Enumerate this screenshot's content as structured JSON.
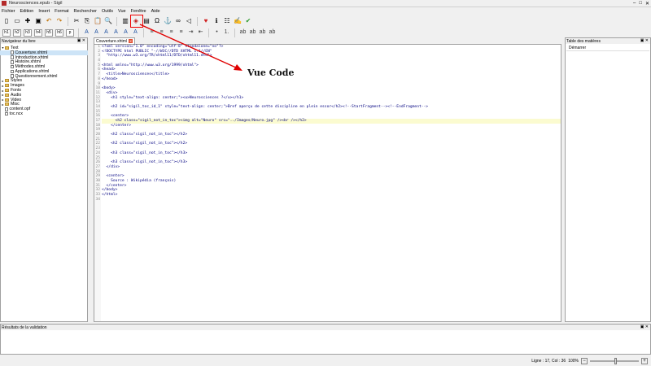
{
  "window": {
    "title": "Neurosciences.epub - Sigil",
    "controls": [
      "–",
      "□",
      "✕"
    ]
  },
  "menu": [
    "Fichier",
    "Edition",
    "Insert",
    "Format",
    "Rechercher",
    "Outils",
    "Vue",
    "Fenêtre",
    "Aide"
  ],
  "toolbar": {
    "icons1": [
      "new-file-icon",
      "open-folder-icon",
      "add-file-icon",
      "save-icon",
      "undo-icon",
      "redo-icon",
      "cut-icon",
      "copy-icon",
      "paste-icon",
      "find-icon",
      "book-view-icon",
      "code-view-icon",
      "insert-image-icon",
      "special-char-icon",
      "anchor-icon",
      "link-icon",
      "back-icon",
      "heart-icon",
      "info-icon",
      "metadata-icon",
      "spellcheck-icon",
      "validate-icon"
    ],
    "glyphs1": [
      "▯",
      "▭",
      "✚",
      "▣",
      "↶",
      "↷",
      "✂",
      "⎘",
      "📋",
      "🔍",
      "▥",
      "◈",
      "▤",
      "Ω",
      "⚓",
      "∞",
      "◁",
      "♥",
      "ℹ",
      "☷",
      "✍",
      "✔"
    ],
    "headings": [
      "h1",
      "h2",
      "h3",
      "h4",
      "h5",
      "h6",
      "p"
    ],
    "icons2": [
      "bold-icon",
      "italic-icon",
      "underline-icon",
      "strike-icon",
      "subscript-icon",
      "superscript-icon",
      "align-left-icon",
      "align-center-icon",
      "align-right-icon",
      "justify-icon",
      "indent-icon",
      "outdent-icon",
      "list-icon",
      "numbered-list-icon",
      "small-ab-icon",
      "smaller-ab-icon",
      "case-ab-icon",
      "case2-ab-icon"
    ],
    "glyphs2": [
      "A",
      "A",
      "A",
      "A",
      "A",
      "A",
      "≡",
      "≡",
      "≡",
      "≡",
      "⇥",
      "⇤",
      "•",
      "1.",
      "ab",
      "ab",
      "ab",
      "ab"
    ]
  },
  "book_browser": {
    "title": "Navigateur du livre",
    "tree": [
      {
        "label": "Text",
        "type": "folder",
        "level": 0,
        "open": true
      },
      {
        "label": "Couverture.xhtml",
        "type": "file",
        "level": 1,
        "selected": true
      },
      {
        "label": "Introduction.xhtml",
        "type": "file",
        "level": 1
      },
      {
        "label": "Histoire.xhtml",
        "type": "file",
        "level": 1
      },
      {
        "label": "Méthodes.xhtml",
        "type": "file",
        "level": 1
      },
      {
        "label": "Applications.xhtml",
        "type": "file",
        "level": 1
      },
      {
        "label": "Questionnement.xhtml",
        "type": "file",
        "level": 1
      },
      {
        "label": "Styles",
        "type": "folder",
        "level": 0
      },
      {
        "label": "Images",
        "type": "folder",
        "level": 0
      },
      {
        "label": "Fonts",
        "type": "folder",
        "level": 0
      },
      {
        "label": "Audio",
        "type": "folder",
        "level": 0
      },
      {
        "label": "Video",
        "type": "folder",
        "level": 0
      },
      {
        "label": "Misc",
        "type": "folder",
        "level": 0
      },
      {
        "label": "content.opf",
        "type": "file",
        "level": 0
      },
      {
        "label": "toc.ncx",
        "type": "file",
        "level": 0
      }
    ]
  },
  "editor": {
    "tab": "Couverture.xhtml",
    "lines": [
      "<?xml version=\"1.0\" encoding=\"utf-8\" standalone=\"no\"?>",
      "<!DOCTYPE html PUBLIC \"-//W3C//DTD XHTML 1.1//EN\"",
      "  \"http://www.w3.org/TR/xhtml11/DTD/xhtml11.dtd\">",
      "",
      "<html xmlns=\"http://www.w3.org/1999/xhtml\">",
      "<head>",
      "  <title>Neurosciences</title>",
      "</head>",
      "",
      "<body>",
      "  <div>",
      "    <h1 style=\"text-align: center;\"><u>Neurosciences ?</u></h1>",
      "",
      "    <h2 id=\"sigil_toc_id_1\" style=\"text-align: center;\">Bref aperçu de cette discipline en plein essor</h2><!--StartFragment--><!--EndFragment-->",
      "",
      "    <center>",
      "      <h2 class=\"sigil_not_in_toc\"><img alt=\"Neuro\" src=\"../Images/Neuro.jpg\" /><br /></h2>",
      "    </center>",
      "",
      "    <h2 class=\"sigil_not_in_toc\"></h2>",
      "",
      "    <h2 class=\"sigil_not_in_toc\"></h2>",
      "",
      "    <h3 class=\"sigil_not_in_toc\"></h3>",
      "",
      "    <h3 class=\"sigil_not_in_toc\"></h3>",
      "  </div>",
      "",
      "  <center>",
      "    Source : Wikipédia (français)",
      "  </center>",
      "</body>",
      "</html>",
      ""
    ],
    "line_numbers": [
      "1",
      "2",
      "3",
      "4",
      "5",
      "6",
      "7",
      "8",
      "9",
      "10",
      "11",
      "12",
      "13",
      "14",
      "15",
      "16",
      "17",
      "18",
      "19",
      "20",
      "21",
      "22",
      "23",
      "24",
      "25",
      "26",
      "27",
      "28",
      "29",
      "30",
      "31",
      "32",
      "33",
      "34"
    ],
    "highlight_line": 17
  },
  "toc": {
    "title": "Table des matières",
    "item": "Démarrer"
  },
  "validation": {
    "title": "Résultats de la validation"
  },
  "status": {
    "position": "Ligne : 17, Col : 36",
    "zoom": "100%"
  },
  "annotation": {
    "label": "Vue Code",
    "color": "#e00000"
  }
}
